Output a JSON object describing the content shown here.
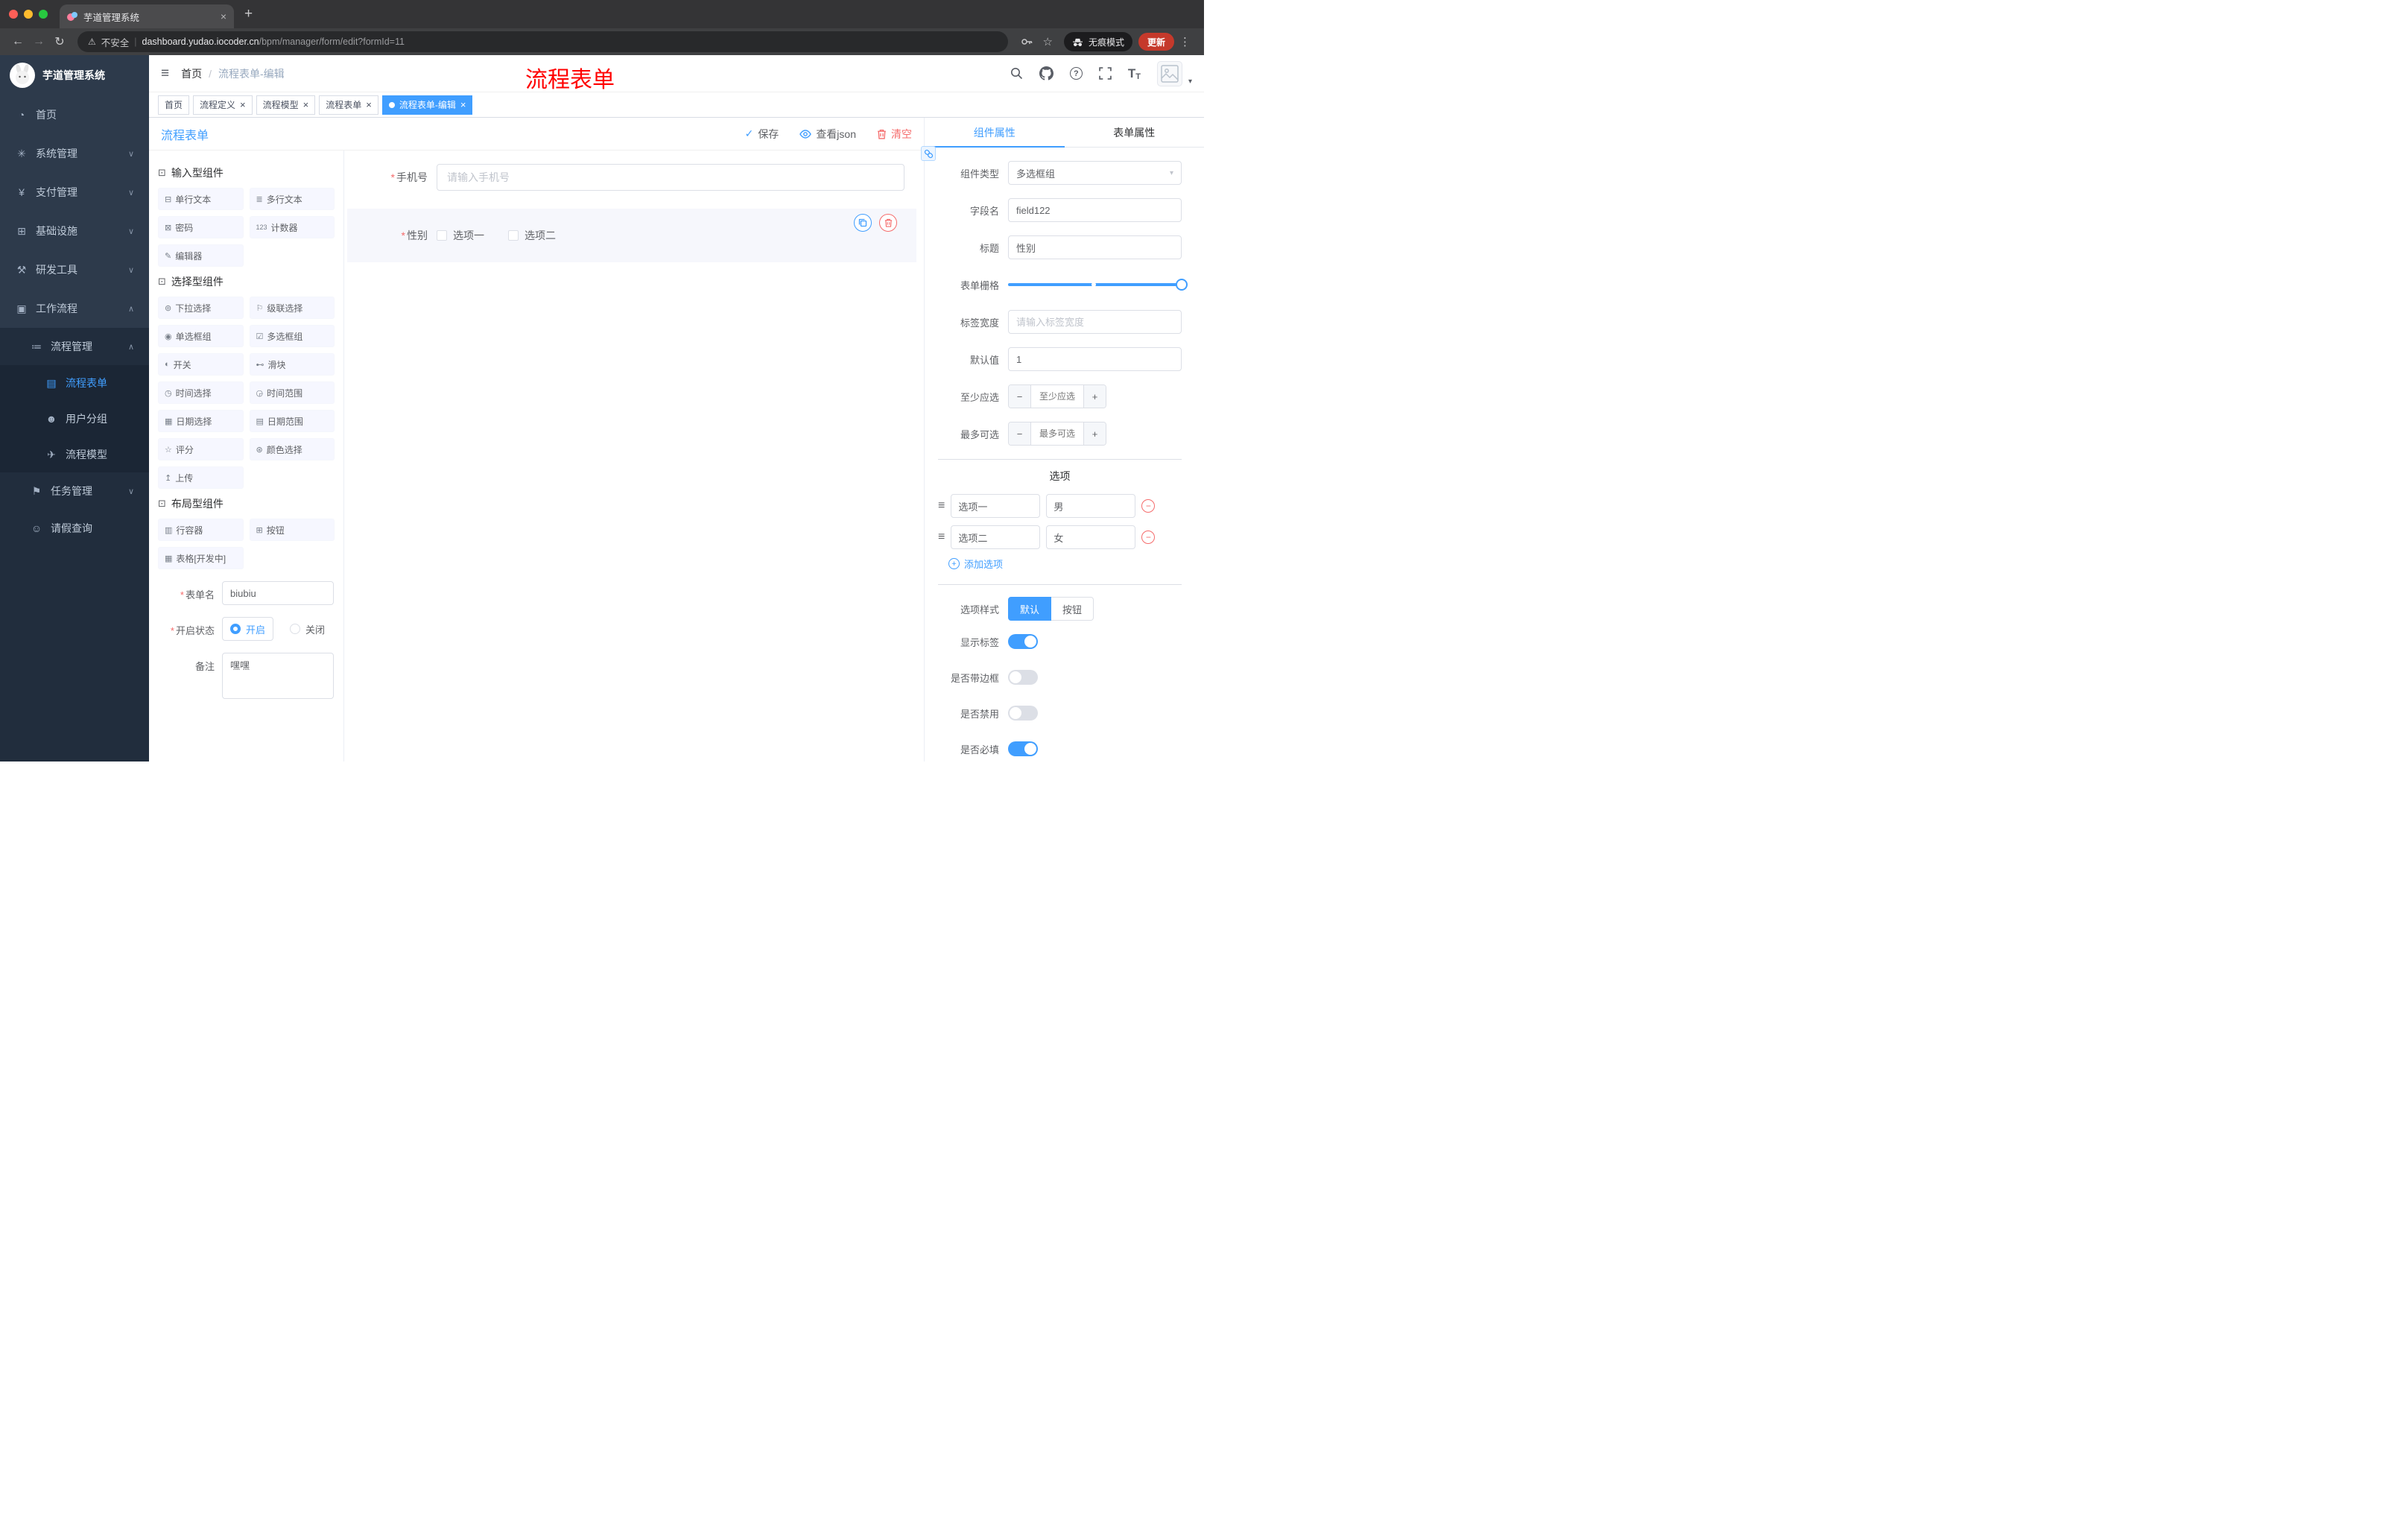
{
  "colors": {
    "accent": "#409eff",
    "danger": "#f56c6c",
    "sidebar_bg": "#2d3a4b",
    "sidebar_sub_bg": "#1b2635",
    "tag_active": "#409eff",
    "annotation_red": "#ff0000",
    "update_pill": "#c5392b"
  },
  "misc": {
    "asterisk": "*",
    "pipe": "|",
    "slash": "/",
    "dots3": "⋮",
    "back": "←",
    "forward": "→",
    "reload": "↻",
    "warning": "⚠",
    "star": "☆",
    "close": "×",
    "plus": "+",
    "caret_down": "▾",
    "chev_down": "∨",
    "chev_up": "∧",
    "check": "✓",
    "minus": "−",
    "hamburger": "≡",
    "question": "?",
    "tag_dot": ""
  },
  "browser": {
    "tab_title": "芋道管理系统",
    "security": "不安全",
    "url_domain": "dashboard.yudao.iocoder.cn",
    "url_path": "/bpm/manager/form/edit?formId=11",
    "incognito": "无痕模式",
    "update": "更新"
  },
  "sidebar": {
    "title": "芋道管理系统",
    "items": [
      {
        "label": "首页",
        "icon": "◔"
      },
      {
        "label": "系统管理",
        "icon": "✳"
      },
      {
        "label": "支付管理",
        "icon": "¥"
      },
      {
        "label": "基础设施",
        "icon": "⊞"
      },
      {
        "label": "研发工具",
        "icon": "⚒"
      },
      {
        "label": "工作流程",
        "icon": "▣"
      }
    ],
    "process_mgmt": {
      "label": "流程管理",
      "icon": "≔"
    },
    "process_children": [
      {
        "label": "流程表单",
        "icon": "▤"
      },
      {
        "label": "用户分组",
        "icon": "☻"
      },
      {
        "label": "流程模型",
        "icon": "✈"
      }
    ],
    "task_mgmt": {
      "label": "任务管理",
      "icon": "⚑"
    },
    "leave_query": {
      "label": "请假查询",
      "icon": "☺"
    }
  },
  "header": {
    "crumb1": "首页",
    "crumb2": "流程表单-编辑",
    "annotation": "流程表单",
    "font_big": "T",
    "font_small": "T"
  },
  "tags": [
    {
      "label": "首页"
    },
    {
      "label": "流程定义"
    },
    {
      "label": "流程模型"
    },
    {
      "label": "流程表单"
    },
    {
      "label": "流程表单-编辑"
    }
  ],
  "designer": {
    "title": "流程表单",
    "save": "保存",
    "view_json": "查看json",
    "clear": "清空",
    "group_icon": "⊡",
    "palette_groups": [
      {
        "title": "输入型组件",
        "items": [
          {
            "label": "单行文本",
            "icon": "⊟"
          },
          {
            "label": "多行文本",
            "icon": "≣"
          },
          {
            "label": "密码",
            "icon": "⊠"
          },
          {
            "label": "计数器",
            "icon": "123"
          },
          {
            "label": "编辑器",
            "icon": "✎"
          }
        ]
      },
      {
        "title": "选择型组件",
        "items": [
          {
            "label": "下拉选择",
            "icon": "⊚"
          },
          {
            "label": "级联选择",
            "icon": "⚐"
          },
          {
            "label": "单选框组",
            "icon": "◉"
          },
          {
            "label": "多选框组",
            "icon": "☑"
          },
          {
            "label": "开关",
            "icon": "◐"
          },
          {
            "label": "滑块",
            "icon": "⊷"
          },
          {
            "label": "时间选择",
            "icon": "◷"
          },
          {
            "label": "时间范围",
            "icon": "◶"
          },
          {
            "label": "日期选择",
            "icon": "▦"
          },
          {
            "label": "日期范围",
            "icon": "▤"
          },
          {
            "label": "评分",
            "icon": "☆"
          },
          {
            "label": "颜色选择",
            "icon": "⊛"
          },
          {
            "label": "上传",
            "icon": "↥"
          }
        ]
      },
      {
        "title": "布局型组件",
        "items": [
          {
            "label": "行容器",
            "icon": "▥"
          },
          {
            "label": "按钮",
            "icon": "⊞"
          },
          {
            "label": "表格[开发中]",
            "icon": "▦"
          }
        ]
      }
    ],
    "form": {
      "name_label": "表单名",
      "name_value": "biubiu",
      "status_label": "开启状态",
      "status_on": "开启",
      "status_off": "关闭",
      "remark_label": "备注",
      "remark_value": "嘿嘿"
    }
  },
  "canvas": {
    "phone_label": "手机号",
    "phone_placeholder": "请输入手机号",
    "gender_label": "性别",
    "gender_opt1": "选项一",
    "gender_opt2": "选项二"
  },
  "props": {
    "tab_component": "组件属性",
    "tab_form": "表单属性",
    "type_label": "组件类型",
    "type_value": "多选框组",
    "field_label": "字段名",
    "field_value": "field122",
    "title_label": "标题",
    "title_value": "性别",
    "grid_label": "表单栅格",
    "width_label": "标签宽度",
    "width_placeholder": "请输入标签宽度",
    "default_label": "默认值",
    "default_value": "1",
    "min_label": "至少应选",
    "min_placeholder": "至少应选",
    "max_label": "最多可选",
    "max_placeholder": "最多可选",
    "options_title": "选项",
    "option_rows": [
      {
        "name": "选项一",
        "value": "男"
      },
      {
        "name": "选项二",
        "value": "女"
      }
    ],
    "add_option": "添加选项",
    "style_label": "选项样式",
    "style_default": "默认",
    "style_button": "按钮",
    "switch_rows": [
      {
        "label": "显示标签",
        "on": true
      },
      {
        "label": "是否带边框",
        "on": false
      },
      {
        "label": "是否禁用",
        "on": false
      },
      {
        "label": "是否必填",
        "on": true
      }
    ]
  }
}
